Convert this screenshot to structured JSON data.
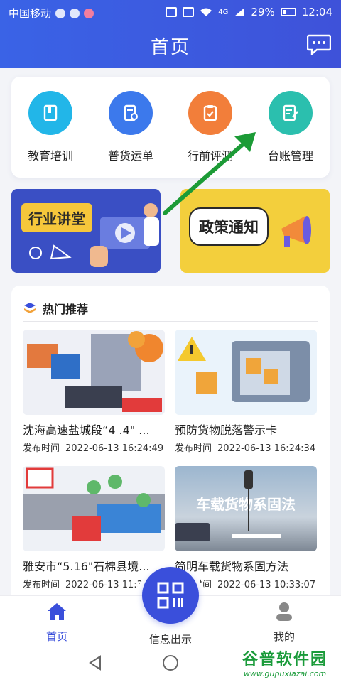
{
  "status_bar": {
    "carrier": "中国移动",
    "network": "4G",
    "battery": "29%",
    "time": "12:04"
  },
  "header": {
    "title": "首页"
  },
  "quick_menu": [
    {
      "label": "教育培训",
      "icon": "book-icon",
      "color": "#22b6e8"
    },
    {
      "label": "普货运单",
      "icon": "document-search-icon",
      "color": "#3c79ec"
    },
    {
      "label": "行前评测",
      "icon": "clipboard-check-icon",
      "color": "#f27e3a"
    },
    {
      "label": "台账管理",
      "icon": "edit-document-icon",
      "color": "#2bbfae"
    }
  ],
  "banners": {
    "left": "行业讲堂",
    "right": "政策通知"
  },
  "hot": {
    "title": "热门推荐",
    "items": [
      {
        "title": "沈海高速盐城段“4 .4\" ...",
        "time_label": "发布时间",
        "time": "2022-06-13 16:24:49"
      },
      {
        "title": "预防货物脱落警示卡",
        "time_label": "发布时间",
        "time": "2022-06-13 16:24:34"
      },
      {
        "title": "雅安市“5.16\"石棉县境...",
        "time_label": "发布时间",
        "time": "2022-06-13 11:3"
      },
      {
        "title": "简明车载货物系固方法",
        "time_label": "发布时间",
        "time": "2022-06-13 10:33:07",
        "overlay": "车载货物系固法"
      }
    ]
  },
  "tabbar": {
    "home": "首页",
    "info": "信息出示",
    "mine": "我的"
  },
  "watermark": {
    "main": "谷普软件园",
    "sub": "www.gupuxiazai.com"
  },
  "colors": {
    "primary": "#3a4fdb",
    "header_start": "#3a63e6",
    "header_end": "#3e52d9"
  }
}
